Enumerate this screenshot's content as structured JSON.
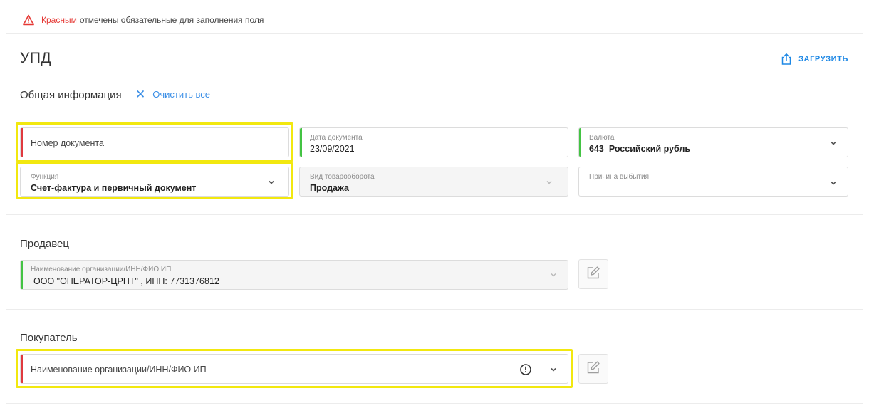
{
  "notice": {
    "icon": "warning-triangle-icon",
    "red_word": "Красным",
    "rest": "отмечены обязательные для заполнения поля",
    "red_color": "#e53935"
  },
  "page": {
    "title": "УПД",
    "upload_label": "ЗАГРУЗИТЬ",
    "upload_icon": "upload-icon",
    "accent_color": "#1e88e5"
  },
  "general": {
    "heading": "Общая информация",
    "clear_label": "Очистить все",
    "clear_icon": "close-icon"
  },
  "fields": {
    "doc_number": {
      "placeholder": "Номер документа",
      "required": true
    },
    "doc_date": {
      "caption": "Дата документа",
      "value": "23/09/2021"
    },
    "currency": {
      "caption": "Валюта",
      "code": "643",
      "name": "Российский рубль"
    },
    "function": {
      "caption": "Функция",
      "value": "Счет-фактура и первичный документ"
    },
    "turnover_type": {
      "caption": "Вид товарооборота",
      "value": "Продажа"
    },
    "disposal_reason": {
      "caption": "Причина выбытия",
      "value": ""
    }
  },
  "seller": {
    "heading": "Продавец",
    "caption": "Наименование организации/ИНН/ФИО ИП",
    "value": "ООО \"ОПЕРАТОР-ЦРПТ\" , ИНН: 7731376812"
  },
  "buyer": {
    "heading": "Покупатель",
    "placeholder": "Наименование организации/ИНН/ФИО ИП"
  },
  "status_colors": {
    "required": "#e0393e",
    "valid": "#43c343",
    "highlight": "#f2e80f"
  }
}
